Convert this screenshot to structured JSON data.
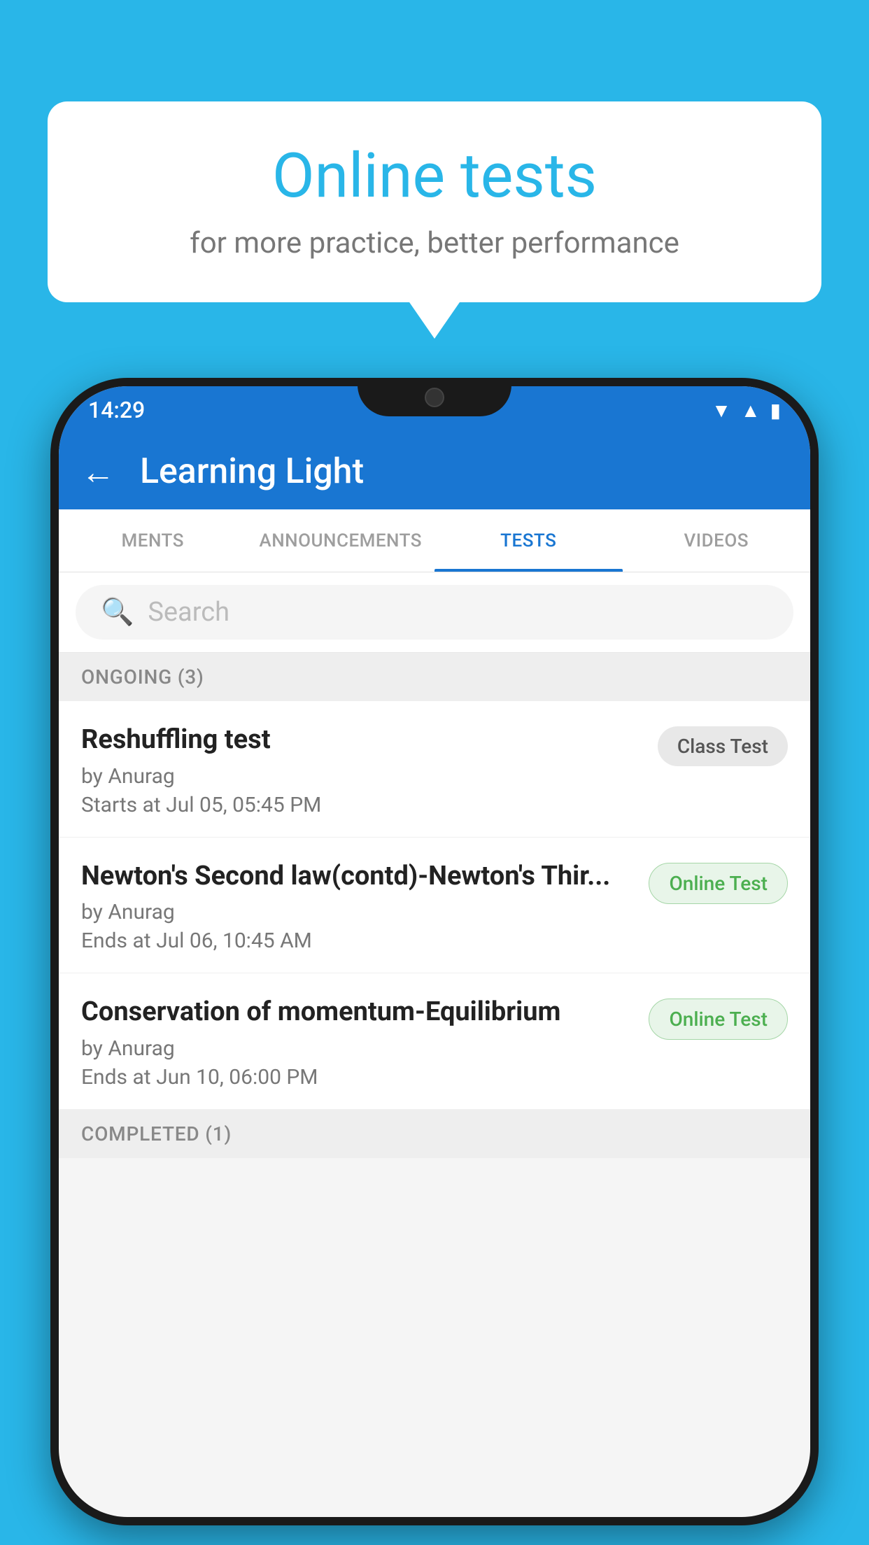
{
  "background": {
    "color": "#29B6E8"
  },
  "speech_bubble": {
    "title": "Online tests",
    "subtitle": "for more practice, better performance"
  },
  "phone": {
    "status_bar": {
      "time": "14:29",
      "icons": [
        "wifi",
        "signal",
        "battery"
      ]
    },
    "app_bar": {
      "back_label": "←",
      "title": "Learning Light"
    },
    "tabs": [
      {
        "label": "MENTS",
        "active": false
      },
      {
        "label": "ANNOUNCEMENTS",
        "active": false
      },
      {
        "label": "TESTS",
        "active": true
      },
      {
        "label": "VIDEOS",
        "active": false
      }
    ],
    "search": {
      "placeholder": "Search"
    },
    "sections": [
      {
        "title": "ONGOING (3)",
        "items": [
          {
            "name": "Reshuffling test",
            "author": "by Anurag",
            "time_label": "Starts at",
            "time": "Jul 05, 05:45 PM",
            "badge": "Class Test",
            "badge_type": "class"
          },
          {
            "name": "Newton's Second law(contd)-Newton's Thir...",
            "author": "by Anurag",
            "time_label": "Ends at",
            "time": "Jul 06, 10:45 AM",
            "badge": "Online Test",
            "badge_type": "online"
          },
          {
            "name": "Conservation of momentum-Equilibrium",
            "author": "by Anurag",
            "time_label": "Ends at",
            "time": "Jun 10, 06:00 PM",
            "badge": "Online Test",
            "badge_type": "online"
          }
        ]
      }
    ],
    "completed_section": {
      "title": "COMPLETED (1)"
    }
  }
}
